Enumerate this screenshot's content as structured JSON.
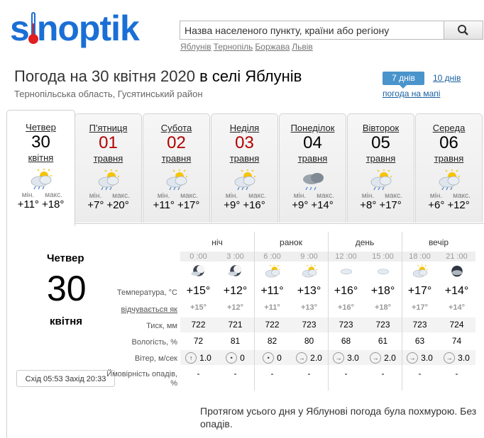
{
  "header": {
    "logo": "sinoptik",
    "search_placeholder": "Назва населеного пункту, країни або регіону",
    "quick_links": [
      "Яблунів",
      "Тернопіль",
      "Боржава",
      "Львів"
    ]
  },
  "title": {
    "prefix": "Погода на 30 квітня 2020",
    "location": "в селі Яблунів",
    "region": "Тернопільська область, Гусятинський район"
  },
  "views": {
    "days7": "7 днів",
    "days10": "10 днів",
    "map": "погода на мапі"
  },
  "days": [
    {
      "name": "Четвер",
      "date": "30",
      "month": "квітня",
      "min_label": "мін.",
      "max_label": "макс.",
      "min": "+11°",
      "max": "+18°",
      "icon": "partly-cloudy-rain-icon"
    },
    {
      "name": "П'ятниця",
      "date": "01",
      "month": "травня",
      "min_label": "мін.",
      "max_label": "макс.",
      "min": "+7°",
      "max": "+20°",
      "icon": "partly-cloudy-rain-icon"
    },
    {
      "name": "Субота",
      "date": "02",
      "month": "травня",
      "min_label": "мін.",
      "max_label": "макс.",
      "min": "+11°",
      "max": "+17°",
      "icon": "partly-cloudy-rain-icon"
    },
    {
      "name": "Неділя",
      "date": "03",
      "month": "травня",
      "min_label": "мін.",
      "max_label": "макс.",
      "min": "+9°",
      "max": "+16°",
      "icon": "partly-cloudy-rain-icon"
    },
    {
      "name": "Понеділок",
      "date": "04",
      "month": "травня",
      "min_label": "мін.",
      "max_label": "макс.",
      "min": "+9°",
      "max": "+14°",
      "icon": "cloudy-rain-icon"
    },
    {
      "name": "Вівторок",
      "date": "05",
      "month": "травня",
      "min_label": "мін.",
      "max_label": "макс.",
      "min": "+8°",
      "max": "+17°",
      "icon": "partly-cloudy-rain-icon"
    },
    {
      "name": "Середа",
      "date": "06",
      "month": "травня",
      "min_label": "мін.",
      "max_label": "макс.",
      "min": "+6°",
      "max": "+12°",
      "icon": "partly-cloudy-rain-icon"
    }
  ],
  "detail": {
    "day_name": "Четвер",
    "day_num": "30",
    "month": "квітня",
    "sun": "Схід 05:53 Захід 20:33",
    "periods": [
      "ніч",
      "ранок",
      "день",
      "вечір"
    ],
    "row_labels": {
      "temp": "Температура, °C",
      "feels": "відчувається як",
      "pressure": "Тиск, мм",
      "humidity": "Вологість, %",
      "wind": "Вітер, м/сек",
      "precip": "Ймовірність опадів, %"
    },
    "hours": [
      "0 :00",
      "3 :00",
      "6 :00",
      "9 :00",
      "12 :00",
      "15 :00",
      "18 :00",
      "21 :00"
    ],
    "icons": [
      "night-cloudy-icon",
      "night-cloudy-icon",
      "partly-cloudy-icon",
      "partly-cloudy-icon",
      "cloud-icon",
      "cloud-icon",
      "partly-cloudy-icon",
      "night-overcast-icon"
    ],
    "temps": [
      "+15°",
      "+12°",
      "+11°",
      "+13°",
      "+16°",
      "+18°",
      "+17°",
      "+14°"
    ],
    "feels": [
      "+15°",
      "+12°",
      "+11°",
      "+13°",
      "+16°",
      "+18°",
      "+17°",
      "+14°"
    ],
    "pressure": [
      "722",
      "721",
      "722",
      "723",
      "723",
      "723",
      "723",
      "724"
    ],
    "humidity": [
      "72",
      "81",
      "82",
      "80",
      "68",
      "61",
      "63",
      "74"
    ],
    "wind_dir": [
      "↑",
      "•",
      "•",
      "→",
      "→",
      "→",
      "→",
      "→"
    ],
    "wind": [
      "1.0",
      "0",
      "0",
      "2.0",
      "3.0",
      "2.0",
      "3.0",
      "3.0"
    ],
    "precip": [
      "-",
      "-",
      "-",
      "-",
      "-",
      "-",
      "-",
      "-"
    ],
    "description": "Протягом усього дня у Яблунові погода була похмурою. Без опадів."
  },
  "colors": {
    "brand": "#1a6fd6",
    "accent": "#4a94cc",
    "red": "#b30000"
  }
}
